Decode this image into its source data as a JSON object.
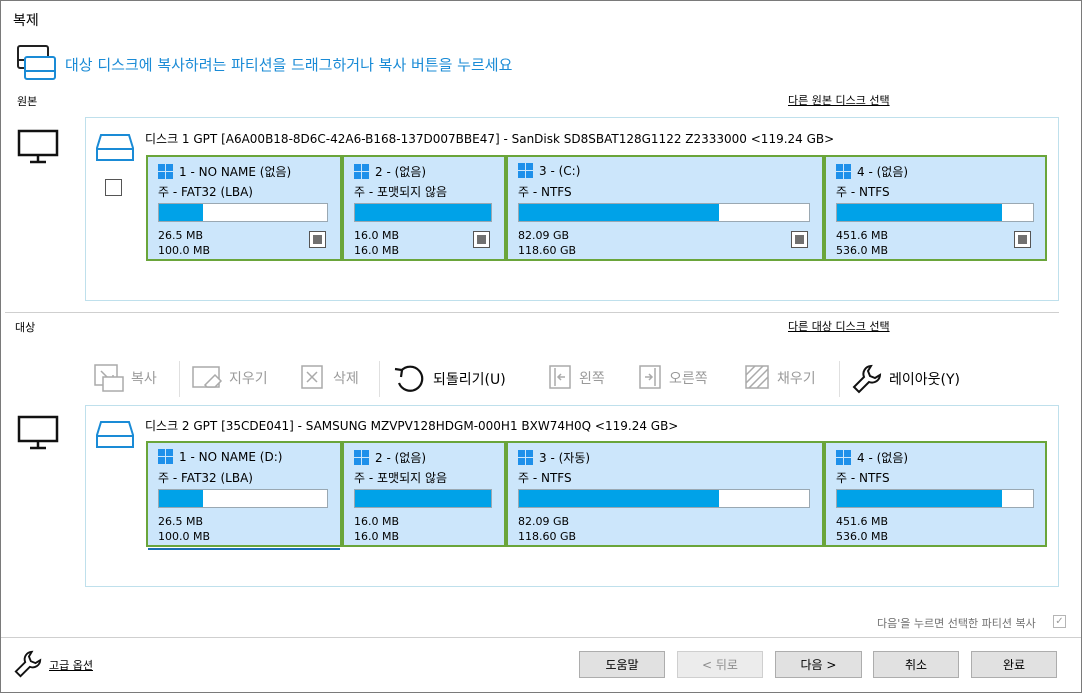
{
  "window": {
    "title": "복제"
  },
  "headline": "대상 디스크에 복사하려는 파티션을 드래그하거나 복사 버튼을 누르세요",
  "source": {
    "label": "원본",
    "link": "다른 원본 디스크 선택",
    "disk_info": "디스크 1 GPT [A6A00B18-8D6C-42A6-B168-137D007BBE47] - SanDisk SD8SBAT128G1122 Z2333000  <119.24 GB>",
    "partitions": [
      {
        "name": "1 - NO NAME (없음)",
        "type": "주 - FAT32 (LBA)",
        "used": "26.5 MB",
        "total": "100.0 MB",
        "fill": 0.26
      },
      {
        "name": "2 -  (없음)",
        "type": "주 - 포맷되지 않음",
        "used": "16.0 MB",
        "total": "16.0 MB",
        "fill": 1.0
      },
      {
        "name": "3 -  (C:)",
        "type": "주 - NTFS",
        "used": "82.09 GB",
        "total": "118.60 GB",
        "fill": 0.69
      },
      {
        "name": "4 -  (없음)",
        "type": "주 - NTFS",
        "used": "451.6 MB",
        "total": "536.0 MB",
        "fill": 0.84
      }
    ]
  },
  "target": {
    "label": "대상",
    "link": "다른 대상 디스크 선택",
    "disk_info": "디스크 2 GPT [35CDE041] - SAMSUNG MZVPV128HDGM-000H1 BXW74H0Q  <119.24 GB>",
    "partitions": [
      {
        "name": "1 - NO NAME (D:)",
        "type": "주 - FAT32 (LBA)",
        "used": "26.5 MB",
        "total": "100.0 MB",
        "fill": 0.26
      },
      {
        "name": "2 -  (없음)",
        "type": "주 - 포맷되지 않음",
        "used": "16.0 MB",
        "total": "16.0 MB",
        "fill": 1.0
      },
      {
        "name": "3 -  (자동)",
        "type": "주 - NTFS",
        "used": "82.09 GB",
        "total": "118.60 GB",
        "fill": 0.69
      },
      {
        "name": "4 -  (없음)",
        "type": "주 - NTFS",
        "used": "451.6 MB",
        "total": "536.0 MB",
        "fill": 0.84
      }
    ]
  },
  "toolbar": {
    "copy": "복사",
    "erase": "지우기",
    "delete": "삭제",
    "undo": "되돌리기(U)",
    "left": "왼쪽",
    "right": "오른쪽",
    "fill": "채우기",
    "layout": "레이아웃(Y)"
  },
  "footer": {
    "option_text": "다음'을 누르면 선택한 파티션 복사",
    "advanced": "고급 옵션",
    "help": "도움말",
    "back": "< 뒤로",
    "next": "다음 >",
    "cancel": "취소",
    "finish": "완료"
  },
  "colors": {
    "accent": "#1a8bd6",
    "bar_fill": "#00a2e8",
    "partition_bg": "#cce6fb",
    "partition_border": "#6aa53a"
  }
}
